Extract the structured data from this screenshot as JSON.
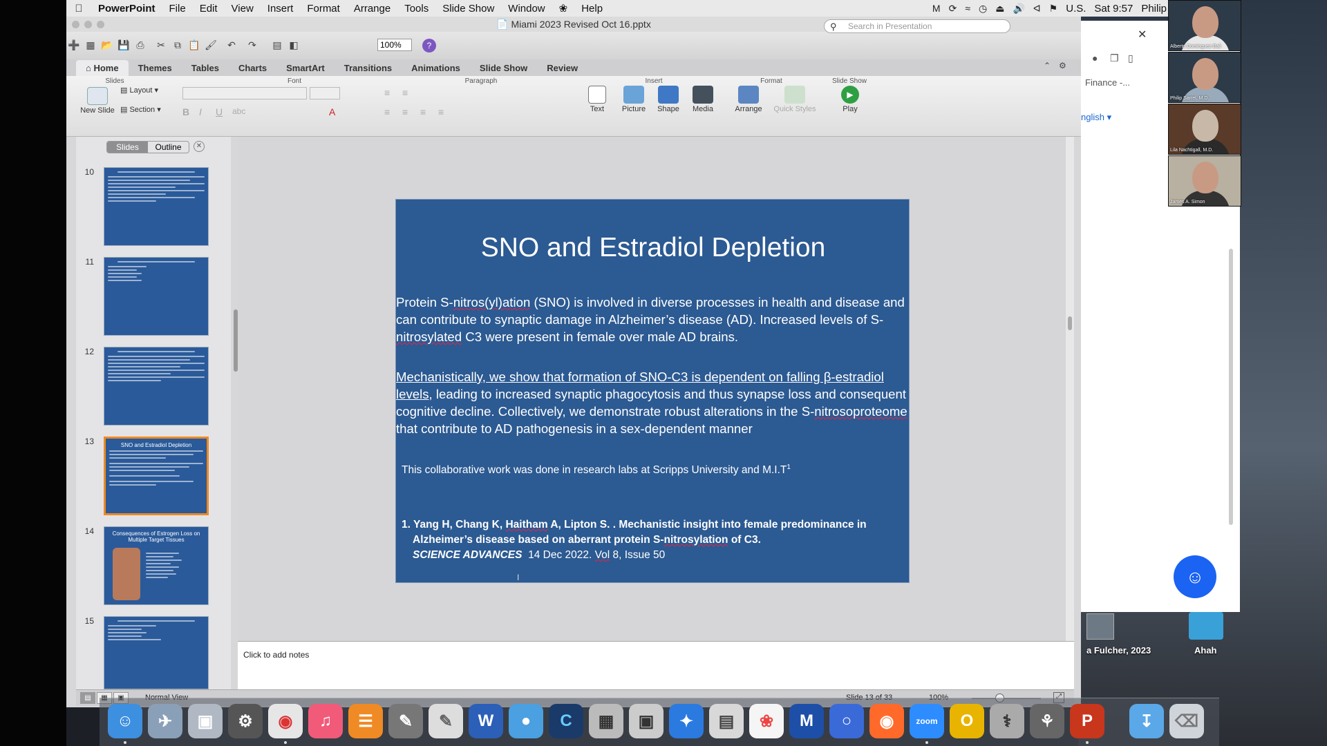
{
  "menubar": {
    "app": "PowerPoint",
    "items": [
      "File",
      "Edit",
      "View",
      "Insert",
      "Format",
      "Arrange",
      "Tools",
      "Slide Show",
      "Window",
      "Help"
    ],
    "input_source": "U.S.",
    "clock": "Sat 9:57",
    "user": "Philip"
  },
  "window": {
    "title": "Miami 2023 Revised Oct 16.pptx",
    "zoom": "100%",
    "search_placeholder": "Search in Presentation"
  },
  "ribbon": {
    "tabs": [
      "Home",
      "Themes",
      "Tables",
      "Charts",
      "SmartArt",
      "Transitions",
      "Animations",
      "Slide Show",
      "Review"
    ],
    "active_tab": "Home",
    "groups": {
      "slides": "Slides",
      "font": "Font",
      "paragraph": "Paragraph",
      "insert": "Insert",
      "format": "Format",
      "slideshow": "Slide Show"
    },
    "buttons": {
      "new_slide": "New Slide",
      "layout": "Layout",
      "section": "Section",
      "text": "Text",
      "picture": "Picture",
      "shape": "Shape",
      "media": "Media",
      "arrange": "Arrange",
      "quick_styles": "Quick Styles",
      "play": "Play"
    }
  },
  "panel": {
    "tabs": [
      "Slides",
      "Outline"
    ],
    "active_tab": "Slides",
    "thumbnails": [
      {
        "num": "10",
        "title": ""
      },
      {
        "num": "11",
        "title": ""
      },
      {
        "num": "12",
        "title": ""
      },
      {
        "num": "13",
        "title": "SNO and Estradiol Depletion"
      },
      {
        "num": "14",
        "title": "Consequences of Estrogen Loss on Multiple Target Tissues"
      },
      {
        "num": "15",
        "title": ""
      }
    ],
    "selected": "13"
  },
  "slide": {
    "title": "SNO and Estradiol Depletion",
    "p1_a": "Protein S-",
    "p1_b": "nitros(yl)ation",
    "p1_c": " (SNO) is involved in diverse processes in health and disease and can contribute to synaptic damage in Alzheimer’s disease (AD). Increased levels of S-",
    "p1_d": "nitrosylated",
    "p1_e": " C3 were present in female over male AD brains.",
    "p2_a": "Mechanistically, we show that formation of SNO-C3 is dependent on falling β-estradiol levels",
    "p2_b": ", leading to increased synaptic phagocytosis and thus synapse loss and consequent cognitive decline. Collectively, we demonstrate robust alterations in the S-",
    "p2_c": "nitrosoproteome",
    "p2_d": " that contribute to AD pathogenesis in a sex-dependent manner",
    "note": "This collaborative work was done in research labs at Scripps University and M.I.T",
    "note_sup": "1",
    "ref_num": "1.",
    "ref_a": "Yang H, Chang K, ",
    "ref_b": "Haitham",
    "ref_c": " A, Lipton S. . Mechanistic insight into female predominance in Alzheimer’s disease based on aberrant protein S-",
    "ref_d": "nitrosylation",
    "ref_e": " of C3.",
    "ref_journal": "SCIENCE ADVANCES",
    "ref_date": "  14 Dec 2022. ",
    "ref_vol": "Vol",
    "ref_rest": " 8, Issue 50"
  },
  "notes_placeholder": "Click to add notes",
  "status": {
    "view": "Normal View",
    "slide_count": "Slide 13 of 33",
    "zoom": "100%"
  },
  "browser": {
    "finance": "Finance -...",
    "language": "nglish"
  },
  "participants": [
    "Alberto Dominguez-Bali",
    "Philip Sarrel, M.D.",
    "Lila Nachtigall, M.D.",
    "James A. Simon"
  ],
  "desktop": {
    "label1": "a Fulcher, 2023",
    "label2": "Ahah"
  }
}
